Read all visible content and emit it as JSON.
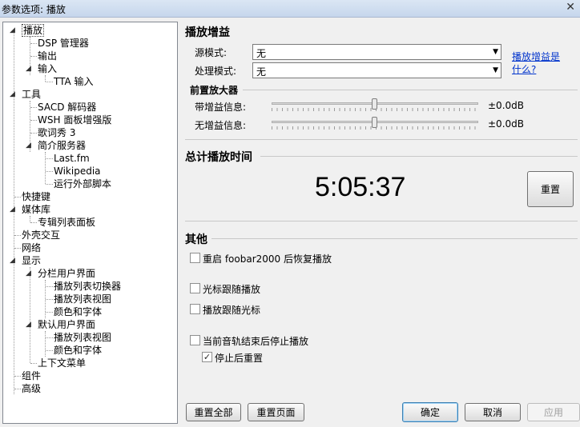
{
  "window": {
    "title": "参数选项: 播放",
    "close_glyph": "✕"
  },
  "tree": {
    "items": [
      {
        "label": "播放"
      },
      {
        "label": "DSP 管理器"
      },
      {
        "label": "输出"
      },
      {
        "label": "输入"
      },
      {
        "label": "TTA 输入"
      },
      {
        "label": "工具"
      },
      {
        "label": "SACD 解码器"
      },
      {
        "label": "WSH 面板增强版"
      },
      {
        "label": "歌词秀 3"
      },
      {
        "label": "简介服务器"
      },
      {
        "label": "Last.fm"
      },
      {
        "label": "Wikipedia"
      },
      {
        "label": "运行外部脚本"
      },
      {
        "label": "快捷键"
      },
      {
        "label": "媒体库"
      },
      {
        "label": "专辑列表面板"
      },
      {
        "label": "外壳交互"
      },
      {
        "label": "网络"
      },
      {
        "label": "显示"
      },
      {
        "label": "分栏用户界面"
      },
      {
        "label": "播放列表切换器"
      },
      {
        "label": "播放列表视图"
      },
      {
        "label": "颜色和字体"
      },
      {
        "label": "默认用户界面"
      },
      {
        "label": "播放列表视图"
      },
      {
        "label": "颜色和字体"
      },
      {
        "label": "上下文菜单"
      },
      {
        "label": "组件"
      },
      {
        "label": "高级"
      }
    ]
  },
  "gain": {
    "heading": "播放增益",
    "source_label": "源模式:",
    "source_value": "无",
    "process_label": "处理模式:",
    "process_value": "无",
    "help_link": "播放增益是什么?",
    "help_link_line1": "播放增益是",
    "help_link_line2": "什么?"
  },
  "preamp": {
    "heading": "前置放大器",
    "with_label": "带增益信息:",
    "with_value": "±0.0dB",
    "with_level": 0.5,
    "without_label": "无增益信息:",
    "without_value": "±0.0dB",
    "without_level": 0.5
  },
  "total": {
    "heading": "总计播放时间",
    "time": "5:05:37",
    "reset": "重置"
  },
  "other": {
    "heading": "其他",
    "opt1": "重启 foobar2000 后恢复播放",
    "opt1_checked": false,
    "opt2": "光标跟随播放",
    "opt2_checked": false,
    "opt3": "播放跟随光标",
    "opt3_checked": false,
    "opt4": "当前音轨结束后停止播放",
    "opt4_checked": false,
    "opt5": "停止后重置",
    "opt5_checked": true
  },
  "footer": {
    "reset_all": "重置全部",
    "reset_page": "重置页面",
    "ok": "确定",
    "cancel": "取消",
    "apply": "应用"
  },
  "glyphs": {
    "checkmark": "✓",
    "combo_arrow": "▼",
    "expanded": "◢"
  }
}
